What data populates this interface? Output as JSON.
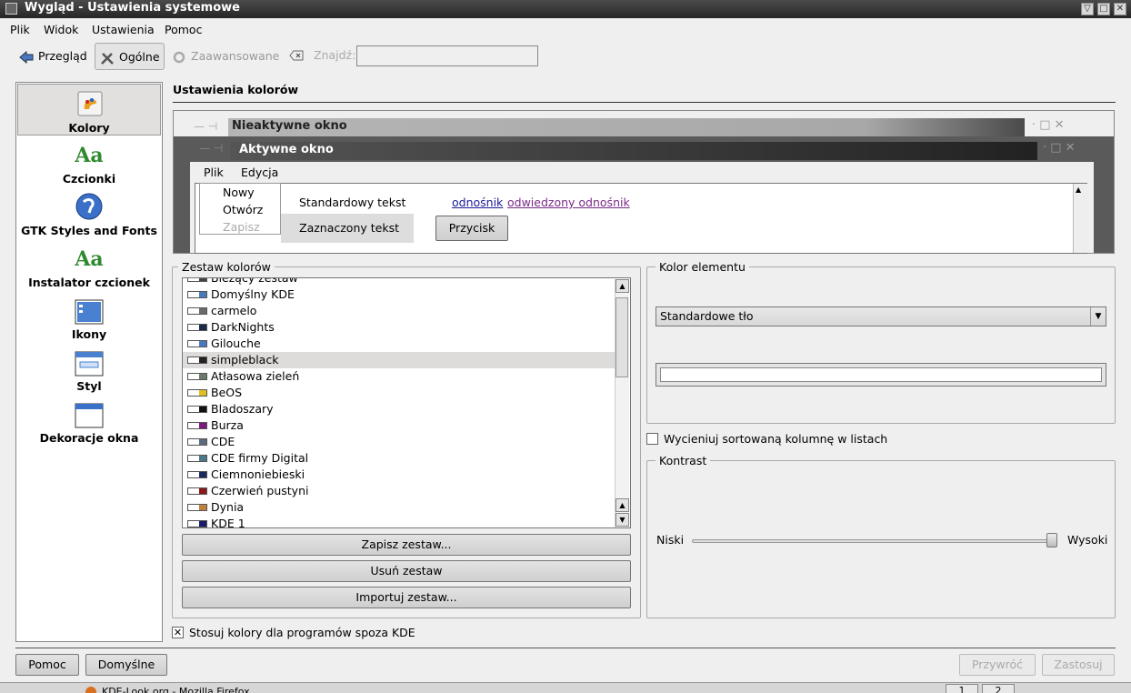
{
  "window": {
    "title": "Wygląd - Ustawienia systemowe"
  },
  "menubar": [
    "Plik",
    "Widok",
    "Ustawienia",
    "Pomoc"
  ],
  "toolbar": {
    "back": "Przegląd",
    "general": "Ogólne",
    "advanced": "Zaawansowane",
    "find_label": "Znajdź:",
    "find_value": ""
  },
  "sidebar": [
    {
      "label": "Kolory",
      "icon": "colors-icon",
      "selected": true
    },
    {
      "label": "Czcionki",
      "icon": "fonts-icon"
    },
    {
      "label": "GTK Styles and Fonts",
      "icon": "gtk-icon"
    },
    {
      "label": "Instalator czcionek",
      "icon": "font-installer-icon"
    },
    {
      "label": "Ikony",
      "icon": "icons-icon"
    },
    {
      "label": "Styl",
      "icon": "style-icon"
    },
    {
      "label": "Dekoracje okna",
      "icon": "window-decorations-icon"
    }
  ],
  "sidebar_icon_glyph": "Aa",
  "main": {
    "title": "Ustawienia kolorów"
  },
  "preview": {
    "inactive_title": "Nieaktywne okno",
    "active_title": "Aktywne okno",
    "menu": [
      "Plik",
      "Edycja"
    ],
    "popup": [
      "Nowy",
      "Otwórz",
      "Zapisz"
    ],
    "standard_text": "Standardowy tekst",
    "link": "odnośnik",
    "visited_link": "odwiedzony odnośnik",
    "selected_text": "Zaznaczony tekst",
    "button": "Przycisk"
  },
  "scheme_group": {
    "label": "Zestaw kolorów",
    "items": [
      {
        "label": "Bieżący zestaw",
        "color": "#444444"
      },
      {
        "label": "Domyślny KDE",
        "color": "#4a7ab8"
      },
      {
        "label": "carmelo",
        "color": "#6a6a6a"
      },
      {
        "label": "DarkNights",
        "color": "#1a2a4a"
      },
      {
        "label": "Gilouche",
        "color": "#4a78c0"
      },
      {
        "label": "simpleblack",
        "color": "#222222",
        "selected": true
      },
      {
        "label": "Atłasowa zieleń",
        "color": "#6a7a6a"
      },
      {
        "label": "BeOS",
        "color": "#e0c020"
      },
      {
        "label": "Bladoszary",
        "color": "#111111"
      },
      {
        "label": "Burza",
        "color": "#7a1a7a"
      },
      {
        "label": "CDE",
        "color": "#5a6a7a"
      },
      {
        "label": "CDE firmy Digital",
        "color": "#4a7a8a"
      },
      {
        "label": "Ciemnoniebieski",
        "color": "#1a2a5a"
      },
      {
        "label": "Czerwień pustyni",
        "color": "#8a1a1a"
      },
      {
        "label": "Dynia",
        "color": "#c08040"
      },
      {
        "label": "KDE 1",
        "color": "#1a1a6a"
      }
    ],
    "save": "Zapisz zestaw...",
    "remove": "Usuń zestaw",
    "import": "Importuj zestaw..."
  },
  "element_group": {
    "label": "Kolor elementu",
    "selected": "Standardowe tło"
  },
  "sort_checkbox": "Wycieniuj sortowaną kolumnę w listach",
  "contrast": {
    "label": "Kontrast",
    "low": "Niski",
    "high": "Wysoki",
    "value_fraction": 0.99
  },
  "apply_non_kde": "Stosuj kolory dla programów spoza KDE",
  "footer": {
    "help": "Pomoc",
    "defaults": "Domyślne",
    "reset": "Przywróć",
    "apply": "Zastosuj"
  },
  "taskbar": {
    "app": "KDE-Look.org - Mozilla Firefox",
    "desktop1": "1",
    "desktop2": "2"
  }
}
